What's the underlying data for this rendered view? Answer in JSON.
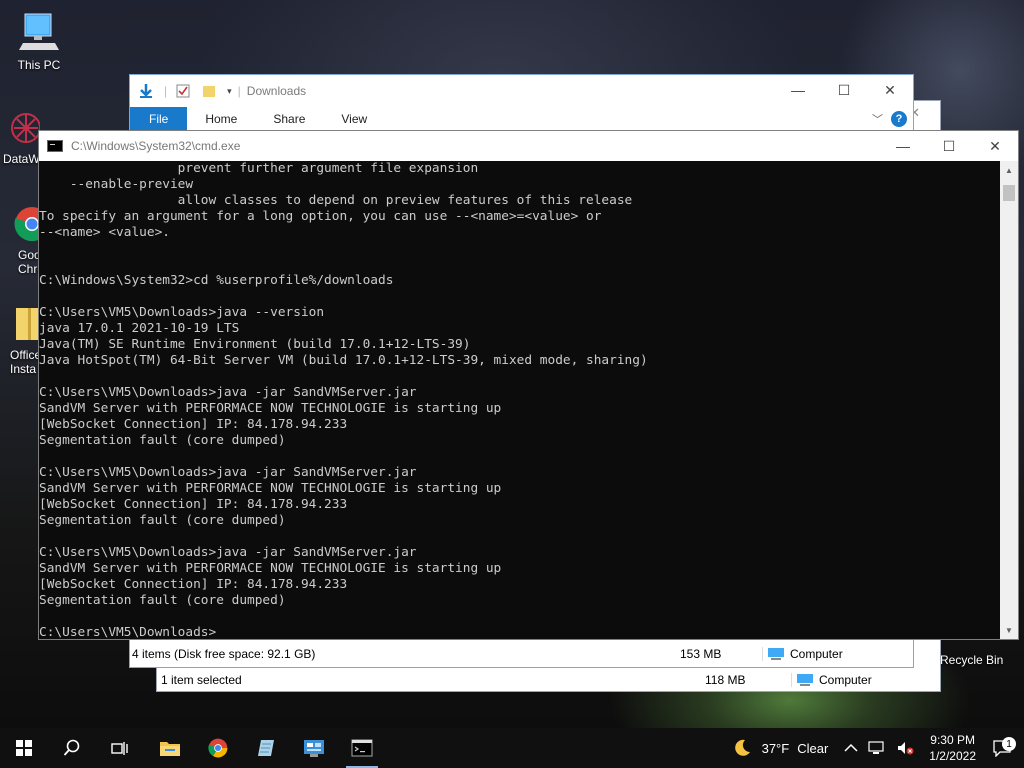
{
  "desktop": {
    "icons": [
      {
        "label": "This PC"
      },
      {
        "label": "DataW"
      },
      {
        "label": "Goo\nChro"
      },
      {
        "label": "Office\nInsta"
      }
    ],
    "recycle_bin": "Recycle Bin"
  },
  "explorer_back": {
    "status_left": "1 item selected",
    "status_size": "118 MB",
    "status_location": "Computer"
  },
  "explorer": {
    "title": "Downloads",
    "tabs": [
      "File",
      "Home",
      "Share",
      "View"
    ],
    "status_left": "4 items (Disk free space: 92.1 GB)",
    "status_size": "153 MB",
    "status_location": "Computer"
  },
  "cmd": {
    "title": "C:\\Windows\\System32\\cmd.exe",
    "lines": [
      "                  prevent further argument file expansion",
      "    --enable-preview",
      "                  allow classes to depend on preview features of this release",
      "To specify an argument for a long option, you can use --<name>=<value> or",
      "--<name> <value>.",
      "",
      "",
      "C:\\Windows\\System32>cd %userprofile%/downloads",
      "",
      "C:\\Users\\VM5\\Downloads>java --version",
      "java 17.0.1 2021-10-19 LTS",
      "Java(TM) SE Runtime Environment (build 17.0.1+12-LTS-39)",
      "Java HotSpot(TM) 64-Bit Server VM (build 17.0.1+12-LTS-39, mixed mode, sharing)",
      "",
      "C:\\Users\\VM5\\Downloads>java -jar SandVMServer.jar",
      "SandVM Server with PERFORMACE NOW TECHNOLOGIE is starting up",
      "[WebSocket Connection] IP: 84.178.94.233",
      "Segmentation fault (core dumped)",
      "",
      "C:\\Users\\VM5\\Downloads>java -jar SandVMServer.jar",
      "SandVM Server with PERFORMACE NOW TECHNOLOGIE is starting up",
      "[WebSocket Connection] IP: 84.178.94.233",
      "Segmentation fault (core dumped)",
      "",
      "C:\\Users\\VM5\\Downloads>java -jar SandVMServer.jar",
      "SandVM Server with PERFORMACE NOW TECHNOLOGIE is starting up",
      "[WebSocket Connection] IP: 84.178.94.233",
      "Segmentation fault (core dumped)",
      "",
      "C:\\Users\\VM5\\Downloads>"
    ]
  },
  "taskbar": {
    "weather_temp": "37°F",
    "weather_desc": "Clear",
    "time": "9:30 PM",
    "date": "1/2/2022",
    "notification_count": "1"
  }
}
